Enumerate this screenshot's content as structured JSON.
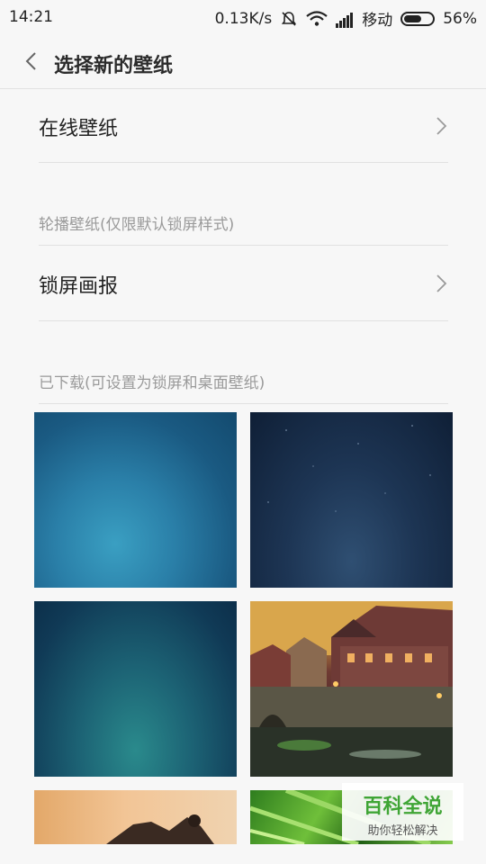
{
  "status_bar": {
    "time": "14:21",
    "speed": "0.13K/s",
    "carrier": "移动",
    "battery": "56%"
  },
  "header": {
    "title": "选择新的壁纸"
  },
  "items": {
    "online_wallpaper": "在线壁纸",
    "carousel_section": "轮播壁纸(仅限默认锁屏样式)",
    "lockscreen_pictorial": "锁屏画报",
    "downloaded_section": "已下载(可设置为锁屏和桌面壁纸)"
  },
  "watermark": {
    "title": "百科全说",
    "subtitle": "助你轻松解决"
  },
  "colors": {
    "background": "#f7f7f7",
    "divider": "#e1e1e1",
    "section_text": "#9a9a9a",
    "watermark_green": "#3fa535"
  }
}
